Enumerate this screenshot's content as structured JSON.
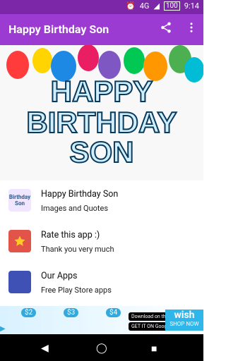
{
  "status": {
    "network": "4G",
    "battery": "100",
    "time": "9:14"
  },
  "appbar": {
    "title": "Happy Birthday Son"
  },
  "hero": {
    "line1": "HAPPY",
    "line2": "BIRTHDAY",
    "line3": "SON"
  },
  "list": [
    {
      "title": "Happy Birthday Son",
      "subtitle": "Images and Quotes",
      "icon_text": "Birthday Son"
    },
    {
      "title": "Rate this app :)",
      "subtitle": "Thank you very much"
    },
    {
      "title": "Our Apps",
      "subtitle": "Free Play Store apps"
    }
  ],
  "ad": {
    "brand": "wish",
    "cta": "SHOP NOW",
    "prices": [
      "$2",
      "$3",
      "$4"
    ],
    "store_badge_1": "Download on the App Store",
    "store_badge_2": "GET IT ON Google Play"
  }
}
